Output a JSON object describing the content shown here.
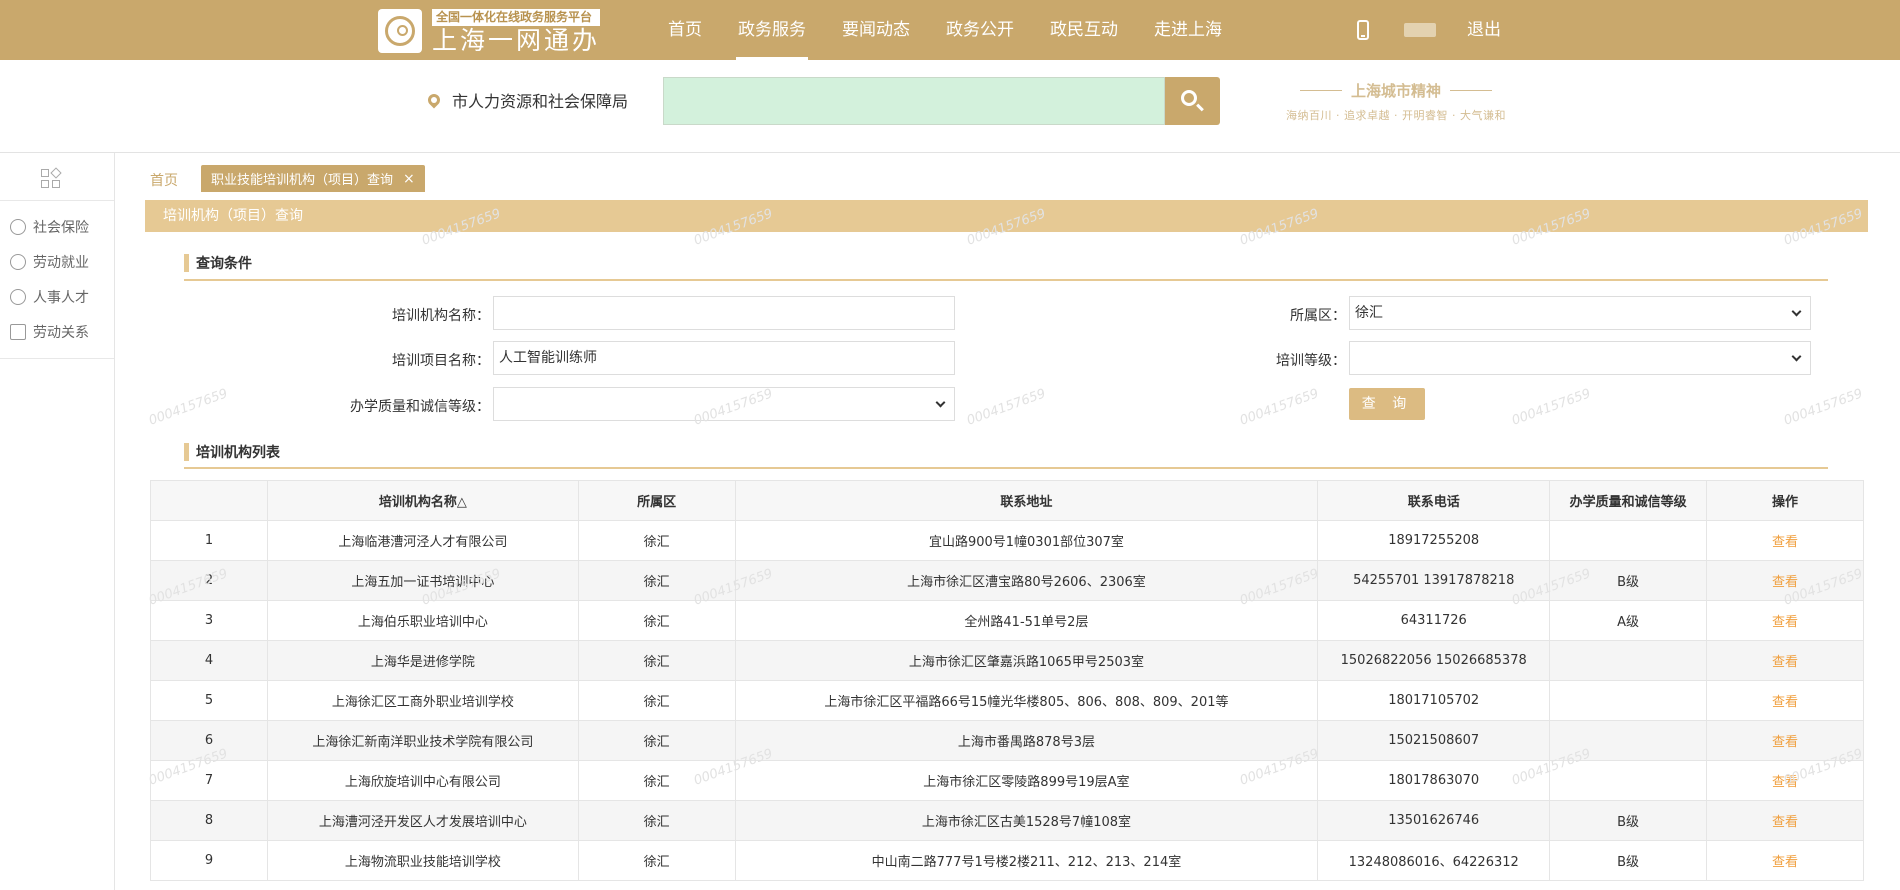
{
  "header": {
    "logo_sub": "全国一体化在线政务服务平台",
    "logo_main": "上海一网通办",
    "nav": [
      "首页",
      "政务服务",
      "要闻动态",
      "政务公开",
      "政民互动",
      "走进上海"
    ],
    "nav_active_index": 1,
    "logout": "退出"
  },
  "search": {
    "location": "市人力资源和社会保障局",
    "value": ""
  },
  "city_spirit": {
    "title": "上海城市精神",
    "subtitle": "海纳百川 · 追求卓越 · 开明睿智 · 大气谦和"
  },
  "sidebar": {
    "items": [
      "社会保险",
      "劳动就业",
      "人事人才",
      "劳动关系"
    ]
  },
  "tabs": {
    "home": "首页",
    "active": "职业技能培训机构（项目）查询",
    "close": "×"
  },
  "panel": {
    "title": "培训机构（项目）查询",
    "query_section": "查询条件",
    "list_section": "培训机构列表"
  },
  "form": {
    "org_name_label": "培训机构名称：",
    "org_name_value": "",
    "project_name_label": "培训项目名称：",
    "project_name_value": "人工智能训练师",
    "quality_label": "办学质量和诚信等级：",
    "quality_value": "",
    "district_label": "所属区：",
    "district_value": "徐汇",
    "level_label": "培训等级：",
    "level_value": "",
    "query_button": "查 询"
  },
  "table": {
    "headers": [
      "",
      "培训机构名称△",
      "所属区",
      "联系地址",
      "联系电话",
      "办学质量和诚信等级",
      "操作"
    ],
    "rows": [
      [
        "1",
        "上海临港漕河泾人才有限公司",
        "徐汇",
        "宜山路900号1幢0301部位307室",
        "18917255208",
        "",
        "查看"
      ],
      [
        "2",
        "上海五加一证书培训中心",
        "徐汇",
        "上海市徐汇区漕宝路80号2606、2306室",
        "54255701 13917878218",
        "B级",
        "查看"
      ],
      [
        "3",
        "上海伯乐职业培训中心",
        "徐汇",
        "全州路41-51单号2层",
        "64311726",
        "A级",
        "查看"
      ],
      [
        "4",
        "上海华是进修学院",
        "徐汇",
        "上海市徐汇区肇嘉浜路1065甲号2503室",
        "15026822056 15026685378",
        "",
        "查看"
      ],
      [
        "5",
        "上海徐汇区工商外职业培训学校",
        "徐汇",
        "上海市徐汇区平福路66号15幢光华楼805、806、808、809、201等",
        "18017105702",
        "",
        "查看"
      ],
      [
        "6",
        "上海徐汇新南洋职业技术学院有限公司",
        "徐汇",
        "上海市番禺路878号3层",
        "15021508607",
        "",
        "查看"
      ],
      [
        "7",
        "上海欣旋培训中心有限公司",
        "徐汇",
        "上海市徐汇区零陵路899号19层A室",
        "18017863070",
        "",
        "查看"
      ],
      [
        "8",
        "上海漕河泾开发区人才发展培训中心",
        "徐汇",
        "上海市徐汇区古美1528号7幢108室",
        "13501626746",
        "B级",
        "查看"
      ],
      [
        "9",
        "上海物流职业技能培训学校",
        "徐汇",
        "中山南二路777号1号楼2楼211、212、213、214室",
        "13248086016、64226312",
        "B级",
        "查看"
      ]
    ]
  },
  "watermark": "0004157659",
  "colors": {
    "brand": "#c9a86c",
    "panel": "#e6c994",
    "link": "#f0a040",
    "search_bg": "#d3f1dc"
  }
}
